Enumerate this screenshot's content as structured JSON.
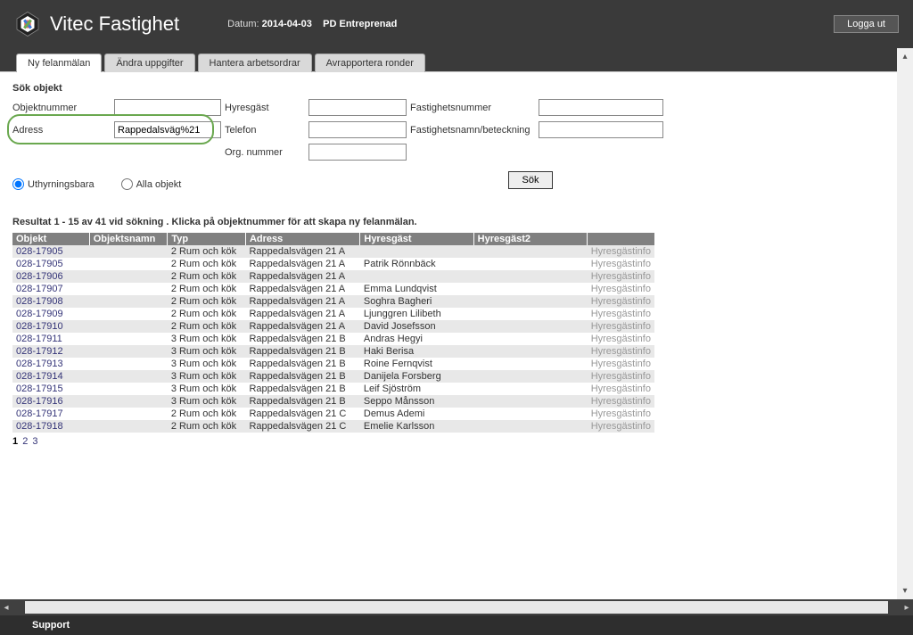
{
  "header": {
    "brand": "Vitec Fastighet",
    "date_label": "Datum: ",
    "date_value": "2014-04-03",
    "org": "PD Entreprenad",
    "logout": "Logga ut"
  },
  "tabs": [
    "Ny felanmälan",
    "Ändra uppgifter",
    "Hantera arbetsordrar",
    "Avrapportera ronder"
  ],
  "search": {
    "title": "Sök objekt",
    "fields": {
      "objektnummer": "Objektnummer",
      "hyresgast": "Hyresgäst",
      "fastighetsnummer": "Fastighetsnummer",
      "adress": "Adress",
      "telefon": "Telefon",
      "fastighetsnamn": "Fastighetsnamn/beteckning",
      "orgnummer": "Org. nummer"
    },
    "values": {
      "adress": "Rappedalsväg%21"
    },
    "radios": [
      "Uthyrningsbara",
      "Alla objekt"
    ],
    "button": "Sök"
  },
  "results": {
    "summary": "Resultat 1 - 15 av 41 vid sökning . Klicka på objektnummer för att skapa ny felanmälan.",
    "columns": [
      "Objekt",
      "Objektsnamn",
      "Typ",
      "Adress",
      "Hyresgäst",
      "Hyresgäst2"
    ],
    "info_label": "Hyresgästinfo",
    "rows": [
      {
        "objekt": "028-17905",
        "namn": "",
        "typ": "2 Rum och kök",
        "adress": "Rappedalsvägen 21 A",
        "hg": "",
        "hg2": ""
      },
      {
        "objekt": "028-17905",
        "namn": "",
        "typ": "2 Rum och kök",
        "adress": "Rappedalsvägen 21 A",
        "hg": "Patrik Rönnbäck",
        "hg2": ""
      },
      {
        "objekt": "028-17906",
        "namn": "",
        "typ": "2 Rum och kök",
        "adress": "Rappedalsvägen 21 A",
        "hg": "",
        "hg2": ""
      },
      {
        "objekt": "028-17907",
        "namn": "",
        "typ": "2 Rum och kök",
        "adress": "Rappedalsvägen 21 A",
        "hg": "Emma Lundqvist",
        "hg2": ""
      },
      {
        "objekt": "028-17908",
        "namn": "",
        "typ": "2 Rum och kök",
        "adress": "Rappedalsvägen 21 A",
        "hg": "Soghra Bagheri",
        "hg2": ""
      },
      {
        "objekt": "028-17909",
        "namn": "",
        "typ": "2 Rum och kök",
        "adress": "Rappedalsvägen 21 A",
        "hg": "Ljunggren Lilibeth",
        "hg2": ""
      },
      {
        "objekt": "028-17910",
        "namn": "",
        "typ": "2 Rum och kök",
        "adress": "Rappedalsvägen 21 A",
        "hg": "David Josefsson",
        "hg2": ""
      },
      {
        "objekt": "028-17911",
        "namn": "",
        "typ": "3 Rum och kök",
        "adress": "Rappedalsvägen 21 B",
        "hg": "Andras Hegyi",
        "hg2": ""
      },
      {
        "objekt": "028-17912",
        "namn": "",
        "typ": "3 Rum och kök",
        "adress": "Rappedalsvägen 21 B",
        "hg": "Haki Berisa",
        "hg2": ""
      },
      {
        "objekt": "028-17913",
        "namn": "",
        "typ": "3 Rum och kök",
        "adress": "Rappedalsvägen 21 B",
        "hg": "Roine Fernqvist",
        "hg2": ""
      },
      {
        "objekt": "028-17914",
        "namn": "",
        "typ": "3 Rum och kök",
        "adress": "Rappedalsvägen 21 B",
        "hg": "Danijela Forsberg",
        "hg2": ""
      },
      {
        "objekt": "028-17915",
        "namn": "",
        "typ": "3 Rum och kök",
        "adress": "Rappedalsvägen 21 B",
        "hg": "Leif Sjöström",
        "hg2": ""
      },
      {
        "objekt": "028-17916",
        "namn": "",
        "typ": "3 Rum och kök",
        "adress": "Rappedalsvägen 21 B",
        "hg": "Seppo Månsson",
        "hg2": ""
      },
      {
        "objekt": "028-17917",
        "namn": "",
        "typ": "2 Rum och kök",
        "adress": "Rappedalsvägen 21 C",
        "hg": "Demus Ademi",
        "hg2": ""
      },
      {
        "objekt": "028-17918",
        "namn": "",
        "typ": "2 Rum och kök",
        "adress": "Rappedalsvägen 21 C",
        "hg": "Emelie Karlsson",
        "hg2": ""
      }
    ]
  },
  "pagination": [
    "1",
    "2",
    "3"
  ],
  "footer": {
    "support": "Support"
  }
}
